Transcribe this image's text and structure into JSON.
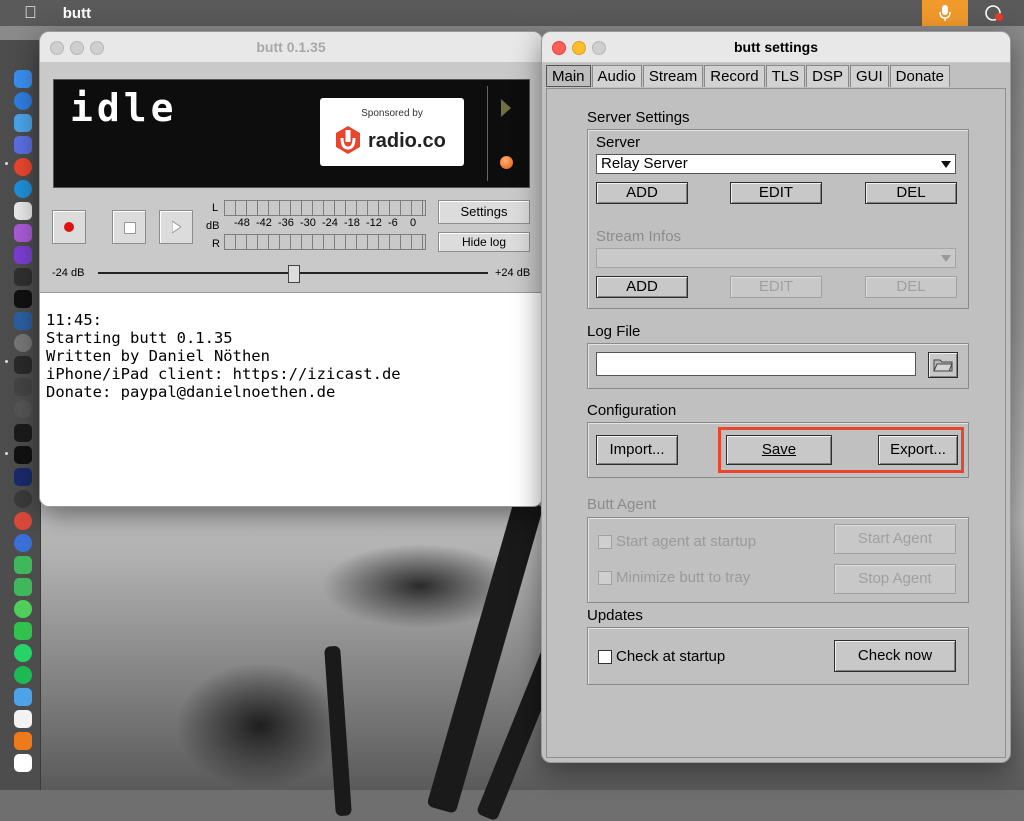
{
  "menubar": {
    "app_name": "butt"
  },
  "main_window": {
    "title": "butt 0.1.35",
    "display_status": "idle",
    "sponsor": {
      "by": "Sponsored by",
      "brand": "radio.co"
    },
    "buttons": {
      "settings": "Settings",
      "hide_log": "Hide log"
    },
    "meter": {
      "channel_left": "L",
      "channel_right": "R",
      "unit": "dB",
      "ticks": [
        "-48",
        "-42",
        "-36",
        "-30",
        "-24",
        "-18",
        "-12",
        "-6",
        "0"
      ]
    },
    "gain": {
      "min_label": "-24 dB",
      "max_label": "+24 dB",
      "value_db": 0
    },
    "log_lines": [
      "11:45:",
      "Starting butt 0.1.35",
      "Written by Daniel Nöthen",
      "iPhone/iPad client: https://izicast.de",
      "Donate: paypal@danielnoethen.de"
    ]
  },
  "settings_window": {
    "title": "butt settings",
    "tabs": [
      {
        "label": "Main",
        "active": true
      },
      {
        "label": "Audio"
      },
      {
        "label": "Stream"
      },
      {
        "label": "Record"
      },
      {
        "label": "TLS"
      },
      {
        "label": "DSP"
      },
      {
        "label": "GUI"
      },
      {
        "label": "Donate"
      }
    ],
    "server_settings": {
      "heading": "Server Settings",
      "server_label": "Server",
      "server_value": "Relay Server",
      "add": "ADD",
      "edit": "EDIT",
      "del": "DEL",
      "stream_infos_label": "Stream Infos",
      "stream_infos_value": "",
      "infos_add": "ADD",
      "infos_edit": "EDIT",
      "infos_del": "DEL"
    },
    "log_file": {
      "heading": "Log File",
      "path": ""
    },
    "configuration": {
      "heading": "Configuration",
      "import": "Import...",
      "save": "Save",
      "export": "Export...",
      "highlight_color": "#e8442e"
    },
    "butt_agent": {
      "heading": "Butt Agent",
      "start_at_startup": "Start agent at startup",
      "minimize_to_tray": "Minimize butt to tray",
      "start_agent": "Start Agent",
      "stop_agent": "Stop Agent"
    },
    "updates": {
      "heading": "Updates",
      "check_at_startup": "Check at startup",
      "check_now": "Check now"
    }
  }
}
